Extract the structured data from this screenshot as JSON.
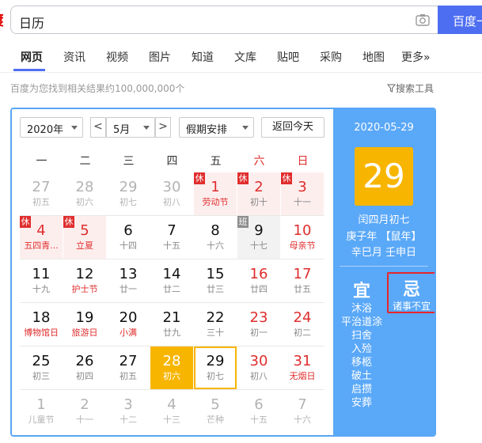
{
  "search": {
    "query": "日历",
    "button_label": "百度一下"
  },
  "tabs": [
    {
      "label": "网页",
      "active": true
    },
    {
      "label": "资讯"
    },
    {
      "label": "视频"
    },
    {
      "label": "图片"
    },
    {
      "label": "知道"
    },
    {
      "label": "文库"
    },
    {
      "label": "贴吧"
    },
    {
      "label": "采购"
    },
    {
      "label": "地图"
    },
    {
      "label": "更多»"
    }
  ],
  "results_count": "百度为您找到相关结果约100,000,000个",
  "search_tools_label": "搜索工具",
  "calendar": {
    "year_select": "2020年",
    "month_select": "5月",
    "holiday_select": "假期安排",
    "today_button": "返回今天",
    "prev_label": "<",
    "next_label": ">",
    "weekdays": [
      "一",
      "二",
      "三",
      "四",
      "五",
      "六",
      "日"
    ],
    "weeks": [
      [
        {
          "d": "27",
          "l": "初五",
          "other": true
        },
        {
          "d": "28",
          "l": "初六",
          "other": true
        },
        {
          "d": "29",
          "l": "初七",
          "other": true
        },
        {
          "d": "30",
          "l": "初八",
          "other": true
        },
        {
          "d": "1",
          "l": "劳动节",
          "holiday": true,
          "tag": "休",
          "fest": true
        },
        {
          "d": "2",
          "l": "初十",
          "holiday": true,
          "tag": "休"
        },
        {
          "d": "3",
          "l": "十一",
          "holiday": true,
          "tag": "休"
        }
      ],
      [
        {
          "d": "4",
          "l": "五四青...",
          "holiday": true,
          "tag": "休",
          "fest": true
        },
        {
          "d": "5",
          "l": "立夏",
          "holiday": true,
          "tag": "休",
          "fest": true
        },
        {
          "d": "6",
          "l": "十四"
        },
        {
          "d": "7",
          "l": "十五"
        },
        {
          "d": "8",
          "l": "十六"
        },
        {
          "d": "9",
          "l": "十七",
          "work": true,
          "tag": "班"
        },
        {
          "d": "10",
          "l": "母亲节",
          "weekend": true,
          "fest": true
        }
      ],
      [
        {
          "d": "11",
          "l": "十九"
        },
        {
          "d": "12",
          "l": "护士节",
          "fest": true
        },
        {
          "d": "13",
          "l": "廿一"
        },
        {
          "d": "14",
          "l": "廿二"
        },
        {
          "d": "15",
          "l": "廿三"
        },
        {
          "d": "16",
          "l": "廿四",
          "weekend": true
        },
        {
          "d": "17",
          "l": "廿五",
          "weekend": true
        }
      ],
      [
        {
          "d": "18",
          "l": "博物馆日",
          "fest": true
        },
        {
          "d": "19",
          "l": "旅游日",
          "fest": true
        },
        {
          "d": "20",
          "l": "小满",
          "fest": true
        },
        {
          "d": "21",
          "l": "廿九"
        },
        {
          "d": "22",
          "l": "三十"
        },
        {
          "d": "23",
          "l": "初一",
          "weekend": true
        },
        {
          "d": "24",
          "l": "初二",
          "weekend": true
        }
      ],
      [
        {
          "d": "25",
          "l": "初三"
        },
        {
          "d": "26",
          "l": "初四"
        },
        {
          "d": "27",
          "l": "初五"
        },
        {
          "d": "28",
          "l": "初六",
          "selected": true
        },
        {
          "d": "29",
          "l": "初七",
          "today": true
        },
        {
          "d": "30",
          "l": "初八",
          "weekend": true
        },
        {
          "d": "31",
          "l": "无烟日",
          "weekend": true,
          "fest": true
        }
      ],
      [
        {
          "d": "1",
          "l": "儿童节",
          "other": true
        },
        {
          "d": "2",
          "l": "十一",
          "other": true
        },
        {
          "d": "3",
          "l": "十二",
          "other": true
        },
        {
          "d": "4",
          "l": "十三",
          "other": true
        },
        {
          "d": "5",
          "l": "芒种",
          "other": true
        },
        {
          "d": "6",
          "l": "十五",
          "other": true
        },
        {
          "d": "7",
          "l": "十六",
          "other": true
        }
      ]
    ]
  },
  "detail": {
    "date": "2020-05-29",
    "day": "29",
    "lunar": "闰四月初七",
    "ganzhi_year": "庚子年 【鼠年】",
    "ganzhi_month_day": "辛巳月 壬申日",
    "yi_label": "宜",
    "yi_items": [
      "沐浴",
      "平治道涂",
      "扫舍",
      "入殓",
      "移柩",
      "破土",
      "启攒",
      "安葬"
    ],
    "ji_label": "忌",
    "ji_text": "诸事不宜"
  },
  "colors": {
    "accent_blue": "#4e6ef2",
    "panel_blue": "#5aa8f8",
    "gold": "#f7b500",
    "holiday_red": "#e02d2d",
    "ji_border": "#e8262a"
  }
}
